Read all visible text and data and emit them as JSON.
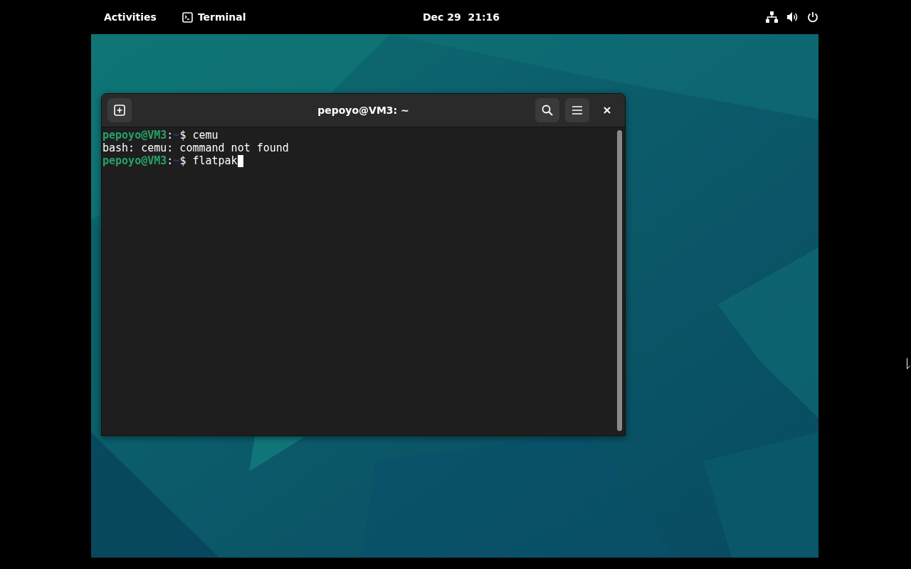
{
  "top_bar": {
    "activities": "Activities",
    "app": {
      "label": "Terminal"
    },
    "clock": "Dec 29  21:16"
  },
  "terminal": {
    "title": "pepoyo@VM3: ~",
    "lines": [
      {
        "segments": [
          {
            "kind": "user",
            "text": "pepoyo@VM3"
          },
          {
            "kind": "sep",
            "text": ":"
          },
          {
            "kind": "path",
            "text": "~"
          },
          {
            "kind": "plain",
            "text": "$ cemu"
          }
        ],
        "cursor": false
      },
      {
        "segments": [
          {
            "kind": "plain",
            "text": "bash: cemu: command not found"
          }
        ],
        "cursor": false
      },
      {
        "segments": [
          {
            "kind": "user",
            "text": "pepoyo@VM3"
          },
          {
            "kind": "sep",
            "text": ":"
          },
          {
            "kind": "path",
            "text": "~"
          },
          {
            "kind": "plain",
            "text": "$ flatpak"
          }
        ],
        "cursor": true
      }
    ]
  }
}
